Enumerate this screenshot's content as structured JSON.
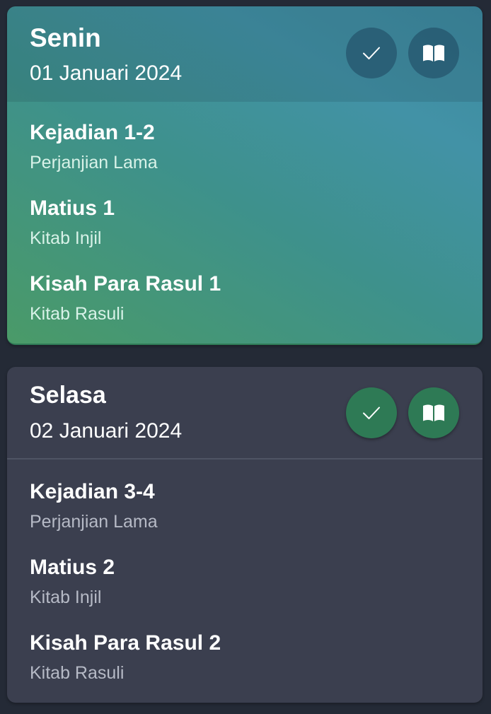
{
  "days": [
    {
      "day": "Senin",
      "date": "01 Januari 2024",
      "readings": [
        {
          "title": "Kejadian 1-2",
          "section": "Perjanjian Lama"
        },
        {
          "title": "Matius 1",
          "section": "Kitab Injil"
        },
        {
          "title": "Kisah Para Rasul 1",
          "section": "Kitab Rasuli"
        }
      ]
    },
    {
      "day": "Selasa",
      "date": "02 Januari 2024",
      "readings": [
        {
          "title": "Kejadian 3-4",
          "section": "Perjanjian Lama"
        },
        {
          "title": "Matius 2",
          "section": "Kitab Injil"
        },
        {
          "title": "Kisah Para Rasul 2",
          "section": "Kitab Rasuli"
        }
      ]
    }
  ],
  "icons": {
    "mark_read": "check-icon",
    "open_reading": "book-icon"
  },
  "colors": {
    "card_active_from": "#4a9a68",
    "card_active_to": "#4292a6",
    "card_default": "#3b3f4f",
    "button_done": "#2e7a55",
    "background": "#242a36"
  }
}
